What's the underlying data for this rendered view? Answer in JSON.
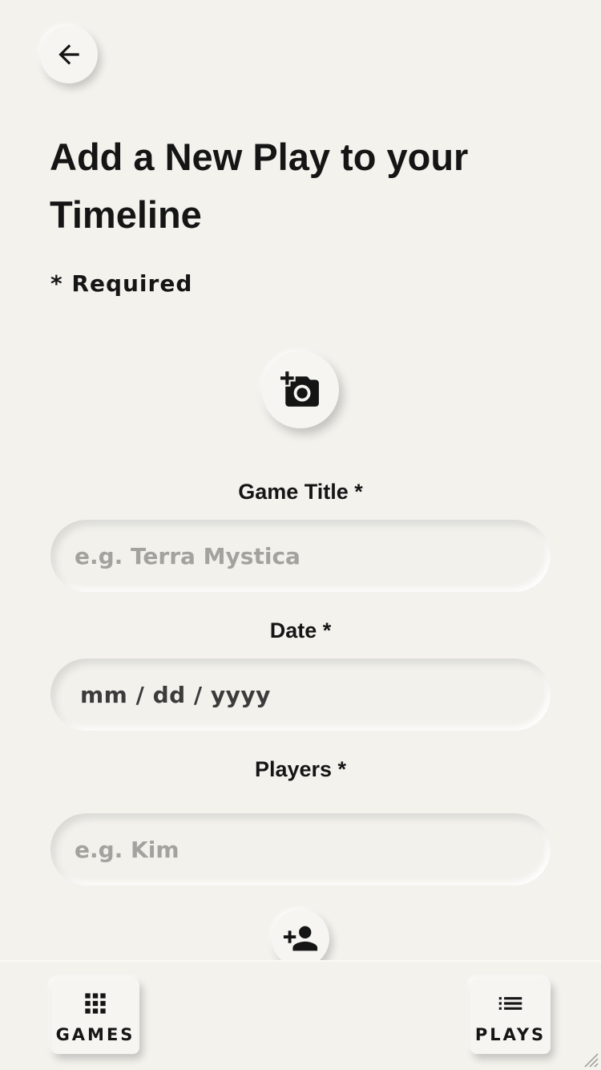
{
  "header": {
    "back_icon": "arrow-left-icon",
    "title": "Add a New Play to your Timeline",
    "required_note": "* Required"
  },
  "photo": {
    "icon": "add-photo-camera-icon"
  },
  "form": {
    "game_title": {
      "label": "Game Title *",
      "placeholder": "e.g. Terra Mystica",
      "value": ""
    },
    "date": {
      "label": "Date *",
      "placeholder": "mm / dd / yyyy",
      "value": "mm / dd / yyyy"
    },
    "players": {
      "label": "Players *",
      "placeholder": "e.g. Kim",
      "value": "",
      "add_icon": "add-person-icon"
    }
  },
  "bottom_nav": {
    "games": {
      "label": "GAMES",
      "icon": "grid-icon"
    },
    "plays": {
      "label": "PLAYS",
      "icon": "list-icon"
    }
  },
  "colors": {
    "background": "#f3f2ed",
    "text": "#151515",
    "placeholder": "#a3a29e"
  }
}
